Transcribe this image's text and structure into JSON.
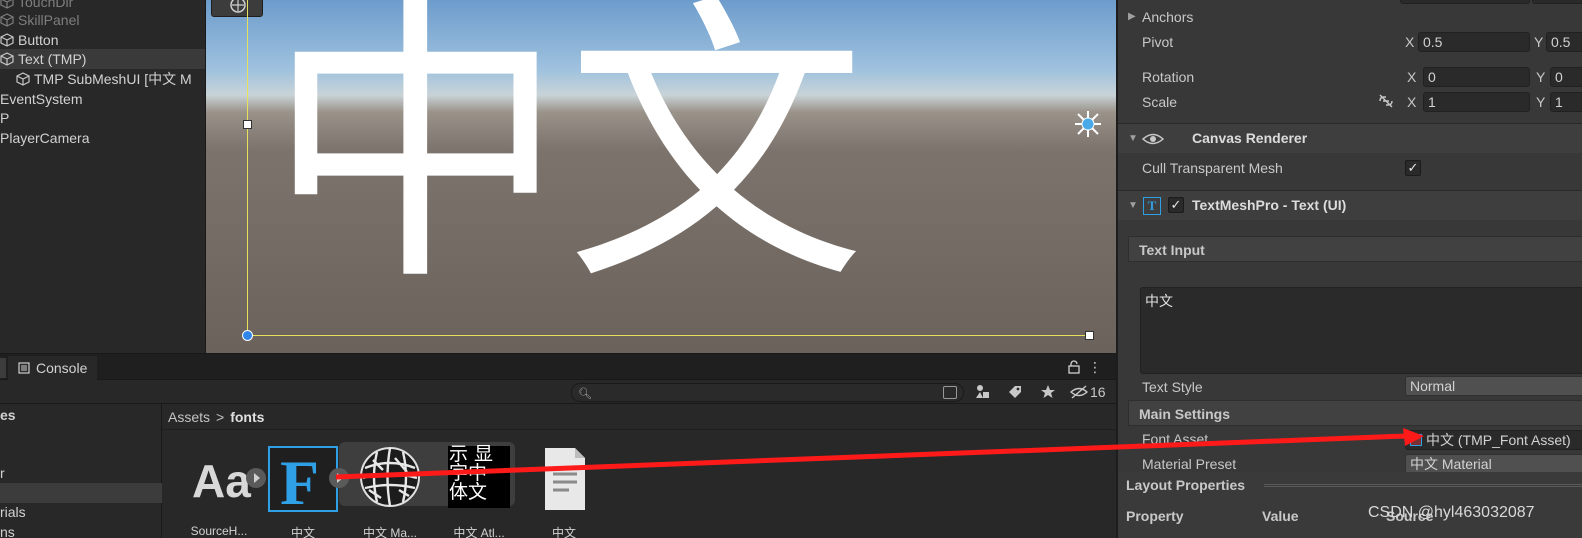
{
  "hierarchy": {
    "items": [
      {
        "label": "TouchDir",
        "style": "disabled"
      },
      {
        "label": "SkillPanel",
        "style": "disabled"
      },
      {
        "label": "Button",
        "style": "normal"
      },
      {
        "label": "Text (TMP)",
        "style": "selected"
      },
      {
        "label": "TMP SubMeshUI [中文 M",
        "style": "normal"
      },
      {
        "label": "EventSystem",
        "style": "normal"
      },
      {
        "label": "P",
        "style": "normal"
      },
      {
        "label": "PlayerCamera",
        "style": "normal"
      }
    ]
  },
  "scene": {
    "text": "中文"
  },
  "bottom_panel": {
    "tab_label": "Console",
    "more_icon": "⋮",
    "hidden_count": "16",
    "search_placeholder": "",
    "folders": [
      {
        "label": "es",
        "style": "bold"
      },
      {
        "label": "",
        "style": "normal"
      },
      {
        "label": "",
        "style": "normal"
      },
      {
        "label": "r",
        "style": "normal"
      },
      {
        "label": "",
        "style": "selected"
      },
      {
        "label": "",
        "style": "normal"
      },
      {
        "label": "rials",
        "style": "normal"
      },
      {
        "label": "ns",
        "style": "normal"
      }
    ],
    "breadcrumb": {
      "root": "Assets",
      "separator": ">",
      "current": "fonts"
    },
    "assets": [
      {
        "label": "SourceH...",
        "icon": "font-icon",
        "thumb_text": "Aa"
      },
      {
        "label": "中文",
        "icon": "font-asset-icon",
        "thumb_text": "F"
      },
      {
        "label": "中文 Ma...",
        "icon": "material-sphere-icon",
        "thumb_text": ""
      },
      {
        "label": "中文 Atl...",
        "icon": "atlas-texture-icon",
        "thumb_text": "示 显字中 体文"
      },
      {
        "label": "中文",
        "icon": "text-file-icon",
        "thumb_text": ""
      }
    ]
  },
  "inspector": {
    "anchors_label": "Anchors",
    "pivot": {
      "label": "Pivot",
      "x_label": "X",
      "x": "0.5",
      "y_label": "Y",
      "y": "0.5"
    },
    "rotation": {
      "label": "Rotation",
      "x_label": "X",
      "x": "0",
      "y_label": "Y",
      "y": "0"
    },
    "scale": {
      "label": "Scale",
      "x_label": "X",
      "x": "1",
      "y_label": "Y",
      "y": "1"
    },
    "canvas_renderer": {
      "title": "Canvas Renderer",
      "cull_label": "Cull Transparent Mesh",
      "cull_checked": "✓"
    },
    "tmp": {
      "title": "TextMeshPro - Text (UI)",
      "enabled_check": "✓",
      "text_input_header": "Text Input",
      "text_value": "中文",
      "text_style_label": "Text Style",
      "text_style_value": "Normal",
      "main_settings_header": "Main Settings",
      "font_asset_label": "Font Asset",
      "font_asset_value": "中文 (TMP_Font Asset)",
      "material_preset_label": "Material Preset",
      "material_preset_value": "中文 Material"
    },
    "layout": {
      "title": "Layout Properties",
      "col_property": "Property",
      "col_value": "Value",
      "col_source": "Source"
    }
  },
  "watermark": "CSDN @hyl463032087",
  "colors": {
    "arrow": "#ff1a1a",
    "accent_blue": "#2f9fe6",
    "rect_yellow": "#e6e05a"
  }
}
